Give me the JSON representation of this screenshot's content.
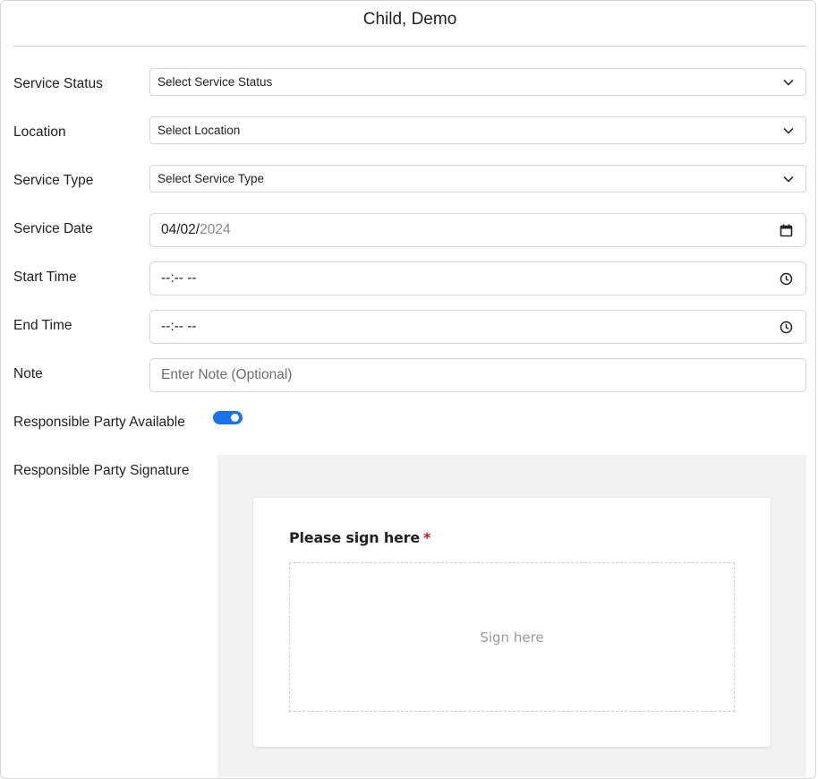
{
  "header": {
    "title": "Child, Demo"
  },
  "form": {
    "service_status": {
      "label": "Service Status",
      "value": "Select Service Status"
    },
    "location": {
      "label": "Location",
      "value": "Select Location"
    },
    "service_type": {
      "label": "Service Type",
      "value": "Select Service Type"
    },
    "service_date": {
      "label": "Service Date",
      "value_month_day": "04/02/",
      "value_year": "2024"
    },
    "start_time": {
      "label": "Start Time",
      "value": "--:-- --"
    },
    "end_time": {
      "label": "End Time",
      "value": "--:-- --"
    },
    "note": {
      "label": "Note",
      "placeholder": "Enter Note (Optional)"
    },
    "responsible_party_available": {
      "label": "Responsible Party Available",
      "checked": true
    },
    "responsible_party_signature": {
      "label": "Responsible Party Signature",
      "prompt": "Please sign here",
      "required_marker": "*",
      "pad_placeholder": "Sign here"
    }
  },
  "icons": {
    "select": "chevron-down-icon",
    "date": "calendar-icon",
    "time": "clock-icon"
  },
  "colors": {
    "accent": "#1a73e8",
    "required": "#d0112b"
  }
}
